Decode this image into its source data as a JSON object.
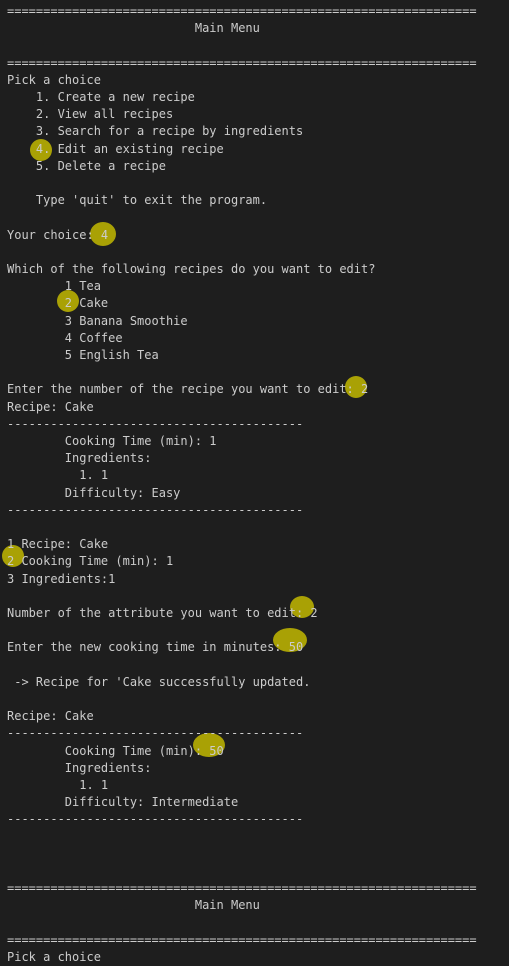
{
  "colors": {
    "background": "#1e1e1e",
    "text": "#cccccc",
    "highlight": "#bfb400"
  },
  "lines": [
    "=================================================================",
    "                          Main Menu",
    "",
    "=================================================================",
    "Pick a choice",
    "    1. Create a new recipe",
    "    2. View all recipes",
    "    3. Search for a recipe by ingredients",
    "    4. Edit an existing recipe",
    "    5. Delete a recipe",
    "",
    "    Type 'quit' to exit the program.",
    "",
    "Your choice: 4",
    "",
    "Which of the following recipes do you want to edit?",
    "        1 Tea",
    "        2 Cake",
    "        3 Banana Smoothie",
    "        4 Coffee",
    "        5 English Tea",
    "",
    "Enter the number of the recipe you want to edit: 2",
    "Recipe: Cake",
    "-----------------------------------------",
    "        Cooking Time (min): 1",
    "        Ingredients:",
    "          1. 1",
    "        Difficulty: Easy",
    "-----------------------------------------",
    "",
    "1 Recipe: Cake",
    "2 Cooking Time (min): 1",
    "3 Ingredients:1",
    "",
    "Number of the attribute you want to edit: 2",
    "",
    "Enter the new cooking time in minutes: 50",
    "",
    " -> Recipe for 'Cake successfully updated.",
    "",
    "Recipe: Cake",
    "-----------------------------------------",
    "        Cooking Time (min): 50",
    "        Ingredients:",
    "          1. 1",
    "        Difficulty: Intermediate",
    "-----------------------------------------",
    "",
    "",
    "",
    "=================================================================",
    "                          Main Menu",
    "",
    "=================================================================",
    "Pick a choice"
  ]
}
